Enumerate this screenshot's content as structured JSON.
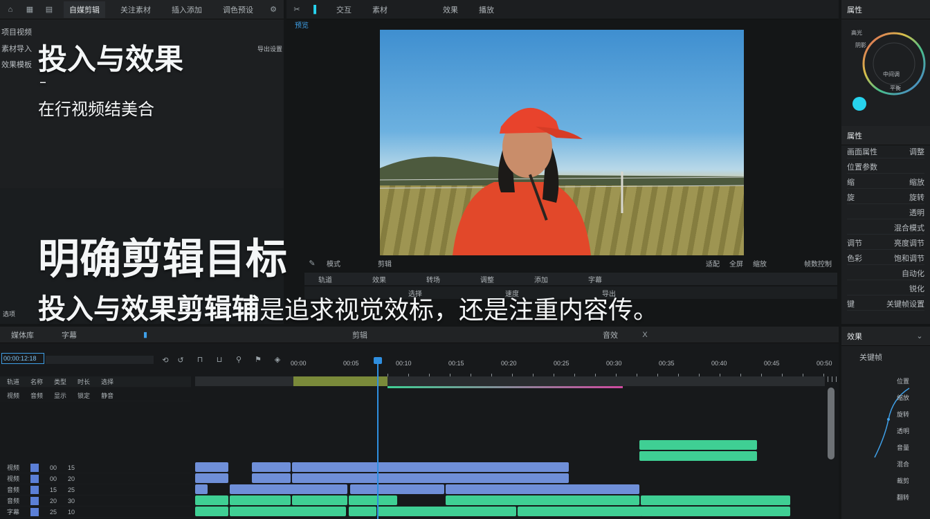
{
  "top_tabs": {
    "left": [
      "自媒剪辑",
      "关注素材",
      "插入添加",
      "调色预设"
    ],
    "viewer": [
      "交互",
      "素材",
      "效果",
      "播放"
    ],
    "viewer_sub": "预览",
    "right": "属性"
  },
  "left_panel": {
    "items": [
      "项目视频",
      "素材导入",
      "效果模板"
    ],
    "side_label": "导出设置",
    "bottom_label": "选项"
  },
  "overlay": {
    "title": "投入与效果",
    "dash": "–",
    "subtitle": "在行视频结美合",
    "heading": "明确剪辑目标",
    "body_highlight": "投入与效果剪辑辅",
    "body_rest": "是追求视觉效标，还是注重内容传。"
  },
  "viewer_controls": {
    "left": [
      "模式",
      "剪辑"
    ],
    "right": [
      "适配",
      "全屏",
      "缩放",
      "帧数控制"
    ],
    "row1": [
      "轨道",
      "效果",
      "转场",
      "调整",
      "添加",
      "字幕"
    ],
    "row2": [
      "选择",
      "速度",
      "导出"
    ]
  },
  "right_panel": {
    "color_title": "色轮",
    "color_labels": [
      "高光",
      "中间调",
      "阴影",
      "平衡"
    ],
    "accent": "#27d3ee",
    "props_title": "属性",
    "props_rows": [
      {
        "k": "画面属性",
        "v": "调整"
      },
      {
        "k": "位置参数",
        "v": ""
      },
      {
        "k": "缩",
        "v": "缩放"
      },
      {
        "k": "旋",
        "v": "旋转"
      },
      {
        "k": "",
        "v": "透明"
      },
      {
        "k": "",
        "v": "混合模式"
      },
      {
        "k": "调节",
        "v": "亮度调节"
      },
      {
        "k": "色彩",
        "v": "饱和调节"
      },
      {
        "k": "",
        "v": "自动化"
      },
      {
        "k": "",
        "v": "锐化"
      },
      {
        "k": "键",
        "v": "关键帧设置"
      }
    ],
    "keys_title": "效果",
    "keys_sub": "关键帧",
    "keys_labels": [
      "位置",
      "缩放",
      "旋转",
      "透明",
      "音量",
      "混合",
      "裁剪",
      "翻转"
    ]
  },
  "timeline": {
    "tabs": [
      "媒体库",
      "字幕",
      "剪辑",
      "音效"
    ],
    "marker": "X",
    "timecode": "00:00:12:18",
    "header_cols": [
      "轨道",
      "名称",
      "类型",
      "时长",
      "选择"
    ],
    "header_cols2": [
      "视频",
      "音频",
      "显示",
      "锁定",
      "静音"
    ],
    "tracks": [
      {
        "name": "视频",
        "t": "00",
        "len": "15"
      },
      {
        "name": "视频",
        "t": "00",
        "len": "20"
      },
      {
        "name": "音频",
        "t": "15",
        "len": "25"
      },
      {
        "name": "音频",
        "t": "20",
        "len": "30"
      },
      {
        "name": "字幕",
        "t": "25",
        "len": "10"
      }
    ],
    "ruler": [
      "00:00",
      "00:05",
      "00:10",
      "00:15",
      "00:20",
      "00:25",
      "00:30",
      "00:35",
      "00:40",
      "00:45",
      "00:50"
    ]
  },
  "colors": {
    "clip_blue": "#6f8fd8",
    "clip_green": "#3fcf94",
    "playhead": "#2f8fe0",
    "accent": "#27d3ee"
  }
}
